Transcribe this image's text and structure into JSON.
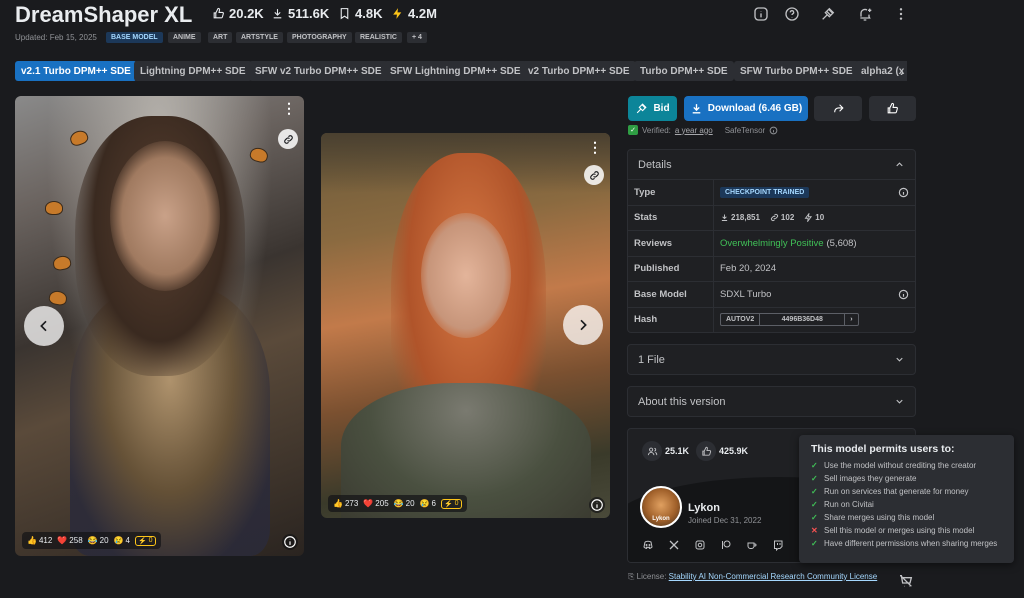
{
  "header": {
    "title": "DreamShaper XL",
    "stats": {
      "likes": "20.2K",
      "downloads": "511.6K",
      "bookmarks": "4.8K",
      "buzz": "4.2M"
    },
    "updated": "Updated: Feb 15, 2025",
    "base_tag": "BASE MODEL",
    "tags": [
      "ANIME",
      "ART",
      "ARTSTYLE",
      "PHOTOGRAPHY",
      "REALISTIC"
    ],
    "more_tags": "+ 4"
  },
  "versions": [
    "v2.1 Turbo DPM++ SDE",
    "Lightning DPM++ SDE",
    "SFW v2 Turbo DPM++ SDE",
    "SFW Lightning DPM++ SDE",
    "v2 Turbo DPM++ SDE",
    "Turbo DPM++ SDE",
    "SFW Turbo DPM++ SDE",
    "alpha2 (x"
  ],
  "images": [
    {
      "reactions": {
        "like": "412",
        "heart": "258",
        "laugh": "20",
        "cry": "4",
        "buzz": "0"
      }
    },
    {
      "reactions": {
        "like": "273",
        "heart": "205",
        "laugh": "20",
        "cry": "6",
        "buzz": "0"
      }
    }
  ],
  "actions": {
    "bid": "Bid",
    "download": "Download (6.46 GB)"
  },
  "verified": {
    "label": "Verified:",
    "when": "a year ago",
    "format": "SafeTensor"
  },
  "details": {
    "heading": "Details",
    "rows": {
      "type": {
        "key": "Type",
        "value": "CHECKPOINT TRAINED"
      },
      "stats": {
        "key": "Stats",
        "downloads": "218,851",
        "generations": "102",
        "buzz": "10"
      },
      "reviews": {
        "key": "Reviews",
        "value": "Overwhelmingly Positive",
        "count": "(5,608)"
      },
      "published": {
        "key": "Published",
        "value": "Feb 20, 2024"
      },
      "base_model": {
        "key": "Base Model",
        "value": "SDXL Turbo"
      },
      "hash": {
        "key": "Hash",
        "type": "AUTOV2",
        "value": "4496B36D48"
      }
    }
  },
  "files": {
    "heading": "1 File"
  },
  "about": {
    "heading": "About this version"
  },
  "creator": {
    "followers": "25.1K",
    "likes": "425.9K",
    "name": "Lykon",
    "joined": "Joined Dec 31, 2022",
    "avatar_text": "Lykon"
  },
  "license": {
    "label": "License:",
    "name": "Stability AI Non-Commercial Research Community License"
  },
  "permissions": {
    "title": "This model permits users to:",
    "items": [
      {
        "text": "Use the model without crediting the creator",
        "allowed": true
      },
      {
        "text": "Sell images they generate",
        "allowed": true
      },
      {
        "text": "Run on services that generate for money",
        "allowed": true
      },
      {
        "text": "Run on Civitai",
        "allowed": true
      },
      {
        "text": "Share merges using this model",
        "allowed": true
      },
      {
        "text": "Sell this model or merges using this model",
        "allowed": false
      },
      {
        "text": "Have different permissions when sharing merges",
        "allowed": true
      }
    ]
  },
  "colors": {
    "accent": "#1971c2",
    "bid": "#0c8599",
    "positive": "#40c057",
    "negative": "#fa5252",
    "buzz": "#fcc419"
  }
}
